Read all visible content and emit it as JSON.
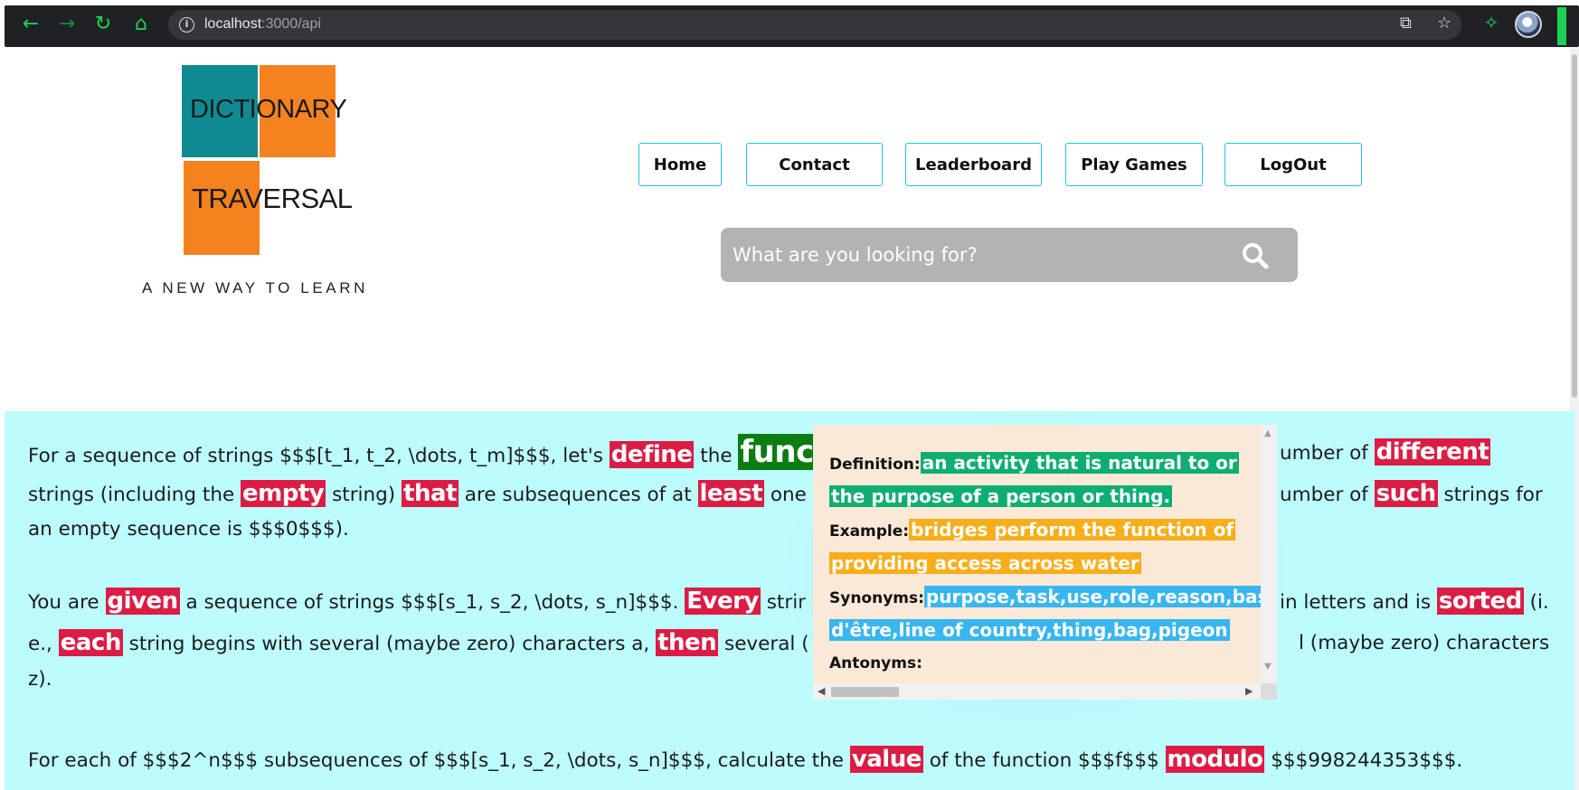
{
  "browser": {
    "url_host": "localhost",
    "url_path": ":3000/api"
  },
  "logo": {
    "word1_a": "DICTI",
    "word1_b": "ONARY",
    "word2_a": "TRAV",
    "word2_b": "ERSAL",
    "tagline": "A NEW WAY TO LEARN"
  },
  "nav": {
    "home": "Home",
    "contact": "Contact",
    "leaderboard": "Leaderboard",
    "play_games": "Play Games",
    "logout": "LogOut"
  },
  "search": {
    "placeholder": "What are you looking for?"
  },
  "content": {
    "p1": [
      "For a sequence of strings $$$[t_1, t_2, \\dots, t_m]$$$, let's ",
      "define",
      " the ",
      "func",
      " ",
      "umber of ",
      "different",
      "strings (including the ",
      "empty",
      " string) ",
      "that",
      " are subsequences of at ",
      "least",
      " one ",
      "umber of ",
      "such",
      " strings for",
      "an empty sequence is $$$0$$$)."
    ],
    "p2": [
      "You are ",
      "given",
      " a sequence of strings $$$[s_1, s_2, \\dots, s_n]$$$. ",
      "Every",
      " strir",
      "in letters and is ",
      "sorted",
      " (i.",
      "e., ",
      "each",
      " string begins with several (maybe zero) characters a, ",
      "then",
      " several (",
      "l (maybe zero) characters",
      "z)."
    ],
    "p3": [
      "For each of $$$2^n$$$ subsequences of $$$[s_1, s_2, \\dots, s_n]$$$, calculate the ",
      "value",
      " of the function $$$f$$$ ",
      "modulo",
      " $$$998244353$$$."
    ]
  },
  "popup": {
    "definition_label": "Definition:",
    "definition_line1": "an activity that is natural to or",
    "definition_line2": "the purpose of a person or thing.",
    "example_label": "Example:",
    "example_line1": "bridges perform the function of",
    "example_line2": "providing access across water",
    "synonyms_label": "Synonyms:",
    "synonyms_line1": "purpose,task,use,role,reason,basis,",
    "synonyms_line2": "d'être,line of country,thing,bag,pigeon",
    "antonyms_label": "Antonyms:",
    "antonyms_value": ""
  },
  "icons": {
    "back": "arrow-left-icon",
    "forward": "arrow-right-icon",
    "reload": "reload-icon",
    "home": "home-icon",
    "info": "info-icon",
    "share": "share-icon",
    "bookmark": "star-icon",
    "extensions": "puzzle-icon",
    "profile": "avatar",
    "search": "search-icon"
  },
  "colors": {
    "browser_accent": "#1fd656",
    "logo_teal": "#0f8a92",
    "logo_orange": "#f4821f",
    "nav_border": "#1cc4e6",
    "search_bg": "#b3b3b3",
    "content_bg": "#bdfcfd",
    "highlight_word": "#dc1c44",
    "highlight_selected": "#0b7d13",
    "popup_bg": "#fae9d7",
    "definition": "#0eae73",
    "example": "#f8ad1a",
    "synonyms": "#38b6f0"
  }
}
